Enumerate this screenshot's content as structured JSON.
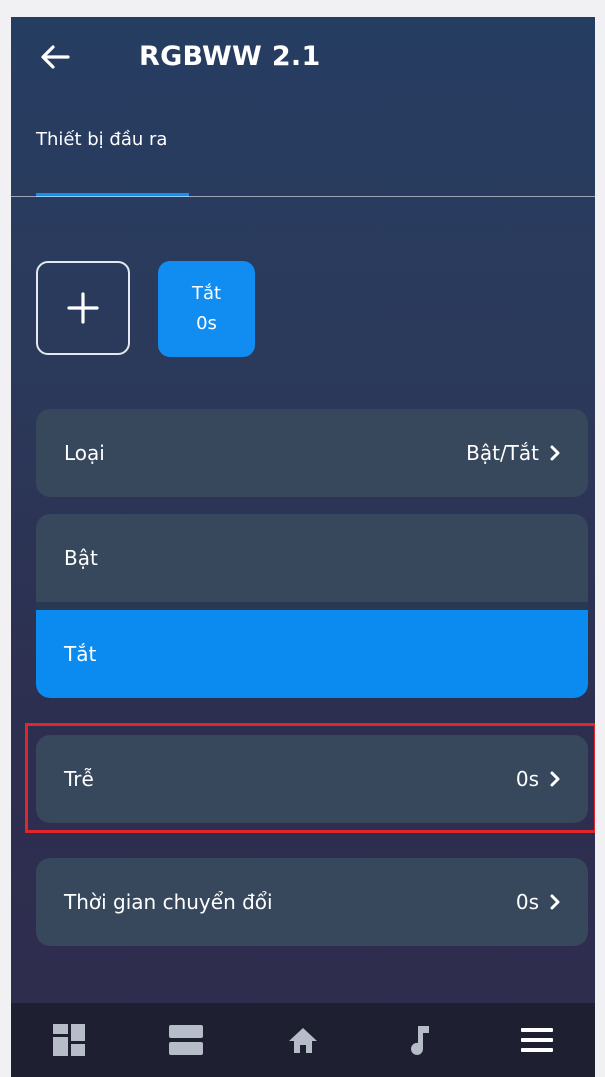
{
  "header": {
    "title": "RGBWW 2.1",
    "back_icon": "arrow-left-icon"
  },
  "tabs": [
    {
      "label": "Thiết bị đầu ra",
      "active": true
    }
  ],
  "scene": {
    "add_icon": "plus-icon",
    "chip": {
      "title": "Tắt",
      "delay": "0s"
    }
  },
  "settings": {
    "type": {
      "label": "Loại",
      "value": "Bật/Tắt"
    },
    "options": [
      {
        "label": "Bật",
        "selected": false
      },
      {
        "label": "Tắt",
        "selected": true
      }
    ],
    "delay": {
      "label": "Trễ",
      "value": "0s"
    },
    "transition": {
      "label": "Thời gian chuyển đổi",
      "value": "0s"
    }
  },
  "bottom_nav": [
    {
      "icon": "dashboard-icon"
    },
    {
      "icon": "rooms-icon"
    },
    {
      "icon": "home-icon"
    },
    {
      "icon": "music-note-icon"
    },
    {
      "icon": "menu-icon"
    }
  ],
  "colors": {
    "accent": "#118cf0",
    "row_bg": "#37485c",
    "highlight": "#e0262a",
    "nav_bg": "#1e2031"
  }
}
